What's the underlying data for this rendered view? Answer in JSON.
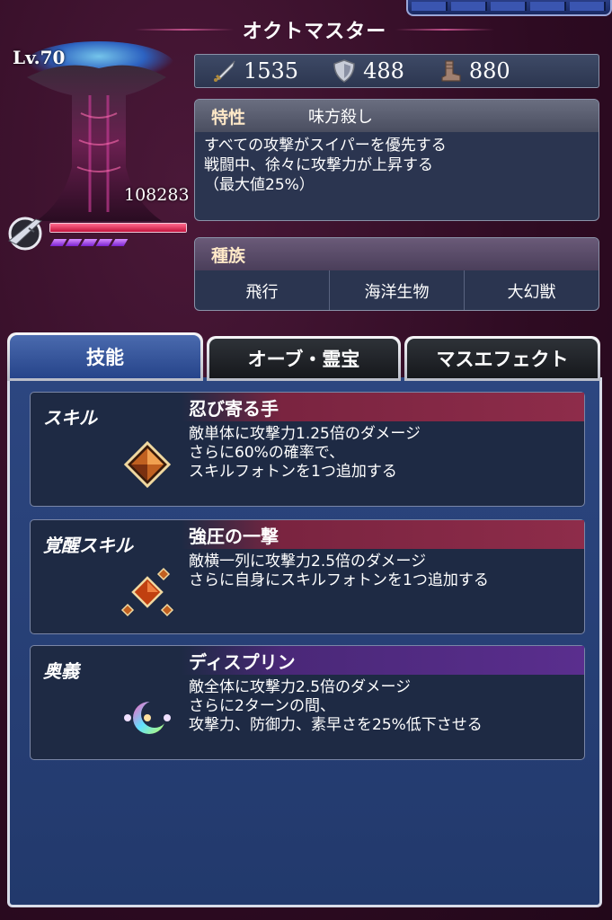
{
  "unit": {
    "name": "オクトマスター",
    "level_label": "Lv.70",
    "hp": "108283",
    "hp_fill_percent": 100
  },
  "stats": {
    "attack": "1535",
    "defense": "488",
    "speed": "880"
  },
  "trait": {
    "label": "特性",
    "name": "味方殺し",
    "description": [
      "すべての攻撃がスイパーを優先する",
      "戦闘中、徐々に攻撃力が上昇する",
      "（最大値25%）"
    ]
  },
  "race": {
    "label": "種族",
    "values": [
      "飛行",
      "海洋生物",
      "大幻獣"
    ]
  },
  "tabs": [
    {
      "label": "技能",
      "active": true
    },
    {
      "label": "オーブ・霊宝",
      "active": false
    },
    {
      "label": "マスエフェクト",
      "active": false
    }
  ],
  "skills": [
    {
      "type": "スキル",
      "name": "忍び寄る手",
      "description": [
        "敵単体に攻撃力1.25倍のダメージ",
        "さらに60%の確率で、",
        "スキルフォトンを1つ追加する"
      ]
    },
    {
      "type": "覚醒スキル",
      "name": "強圧の一撃",
      "description": [
        "敵横一列に攻撃力2.5倍のダメージ",
        "さらに自身にスキルフォトンを1つ追加する"
      ]
    },
    {
      "type": "奥義",
      "name": "ディスプリン",
      "description": [
        "敵全体に攻撃力2.5倍のダメージ",
        "さらに2ターンの間、",
        "攻撃力、防御力、素早さを25%低下させる"
      ]
    }
  ],
  "colors": {
    "background": "#3a0f2a",
    "panel": "#26448a",
    "skill_bar_red": "#8e2c4a",
    "skill_bar_purple": "#5a2e8e"
  },
  "icons": {
    "attack": "sword-icon",
    "defense": "shield-icon",
    "speed": "boot-icon",
    "weapon_type": "rifle-icon"
  }
}
